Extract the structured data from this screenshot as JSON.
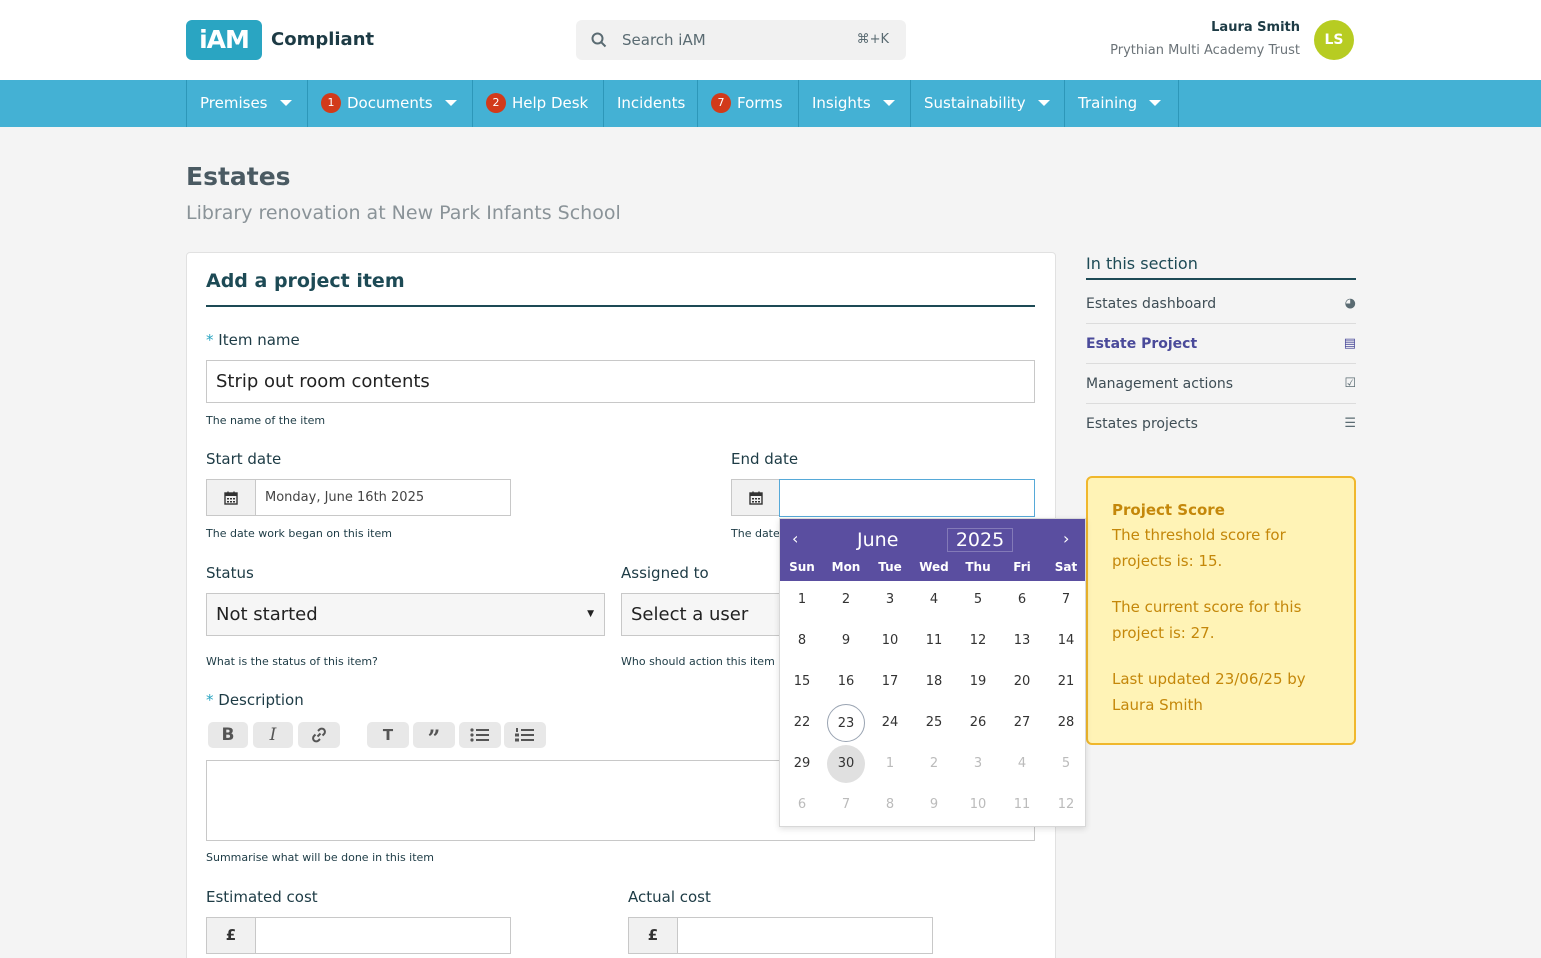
{
  "header": {
    "logo": "iAM",
    "product": "Compliant",
    "search_placeholder": "Search iAM",
    "search_shortcut": "⌘+K",
    "user_name": "Laura Smith",
    "user_org": "Prythian Multi Academy Trust",
    "avatar_initials": "LS"
  },
  "nav": [
    {
      "label": "Premises",
      "badge": "",
      "dropdown": true
    },
    {
      "label": "Documents",
      "badge": "1",
      "dropdown": true
    },
    {
      "label": "Help Desk",
      "badge": "2",
      "dropdown": false
    },
    {
      "label": "Incidents",
      "badge": "",
      "dropdown": false
    },
    {
      "label": "Forms",
      "badge": "7",
      "dropdown": false
    },
    {
      "label": "Insights",
      "badge": "",
      "dropdown": true
    },
    {
      "label": "Sustainability",
      "badge": "",
      "dropdown": true
    },
    {
      "label": "Training",
      "badge": "",
      "dropdown": true
    }
  ],
  "page": {
    "title": "Estates",
    "subtitle": "Library renovation at New Park Infants School"
  },
  "form": {
    "title": "Add a project item",
    "item_name_label": "Item name",
    "item_name_value": "Strip out room contents",
    "item_name_help": "The name of the item",
    "start_date_label": "Start date",
    "start_date_value": "Monday, June 16th 2025",
    "start_date_help": "The date work began on this item",
    "end_date_label": "End date",
    "end_date_value": "",
    "end_date_help": "The date",
    "status_label": "Status",
    "status_value": "Not started",
    "status_help": "What is the status of this item?",
    "assigned_label": "Assigned to",
    "assigned_value": "Select a user",
    "assigned_help": "Who should action this item",
    "description_label": "Description",
    "description_help": "Summarise what will be done in this item",
    "estimated_cost_label": "Estimated cost",
    "actual_cost_label": "Actual cost",
    "currency": "£",
    "toolbar": {
      "bold": "B",
      "italic": "I",
      "heading": "T",
      "quote": "”"
    }
  },
  "sidebar": {
    "heading": "In this section",
    "items": [
      {
        "label": "Estates dashboard",
        "icon": "dashboard-icon",
        "active": false
      },
      {
        "label": "Estate Project",
        "icon": "building-icon",
        "active": true
      },
      {
        "label": "Management actions",
        "icon": "checkbox-icon",
        "active": false
      },
      {
        "label": "Estates projects",
        "icon": "list-icon",
        "active": false
      }
    ]
  },
  "score": {
    "title": "Project Score",
    "threshold": "The threshold score for projects is: 15.",
    "current": "The current score for this project is: 27.",
    "updated": "Last updated 23/06/25 by Laura Smith",
    "border_color": "#f0b72c",
    "bg_color": "#fff3b6"
  },
  "calendar": {
    "month": "June",
    "year": "2025",
    "weekdays": [
      "Sun",
      "Mon",
      "Tue",
      "Wed",
      "Thu",
      "Fri",
      "Sat"
    ],
    "weeks": [
      [
        "1",
        "2",
        "3",
        "4",
        "5",
        "6",
        "7"
      ],
      [
        "8",
        "9",
        "10",
        "11",
        "12",
        "13",
        "14"
      ],
      [
        "15",
        "16",
        "17",
        "18",
        "19",
        "20",
        "21"
      ],
      [
        "22",
        "23",
        "24",
        "25",
        "26",
        "27",
        "28"
      ],
      [
        "29",
        "30",
        "1",
        "2",
        "3",
        "4",
        "5"
      ],
      [
        "6",
        "7",
        "8",
        "9",
        "10",
        "11",
        "12"
      ]
    ],
    "today": "23",
    "selected": "30",
    "header_color": "#5a4ea0"
  }
}
